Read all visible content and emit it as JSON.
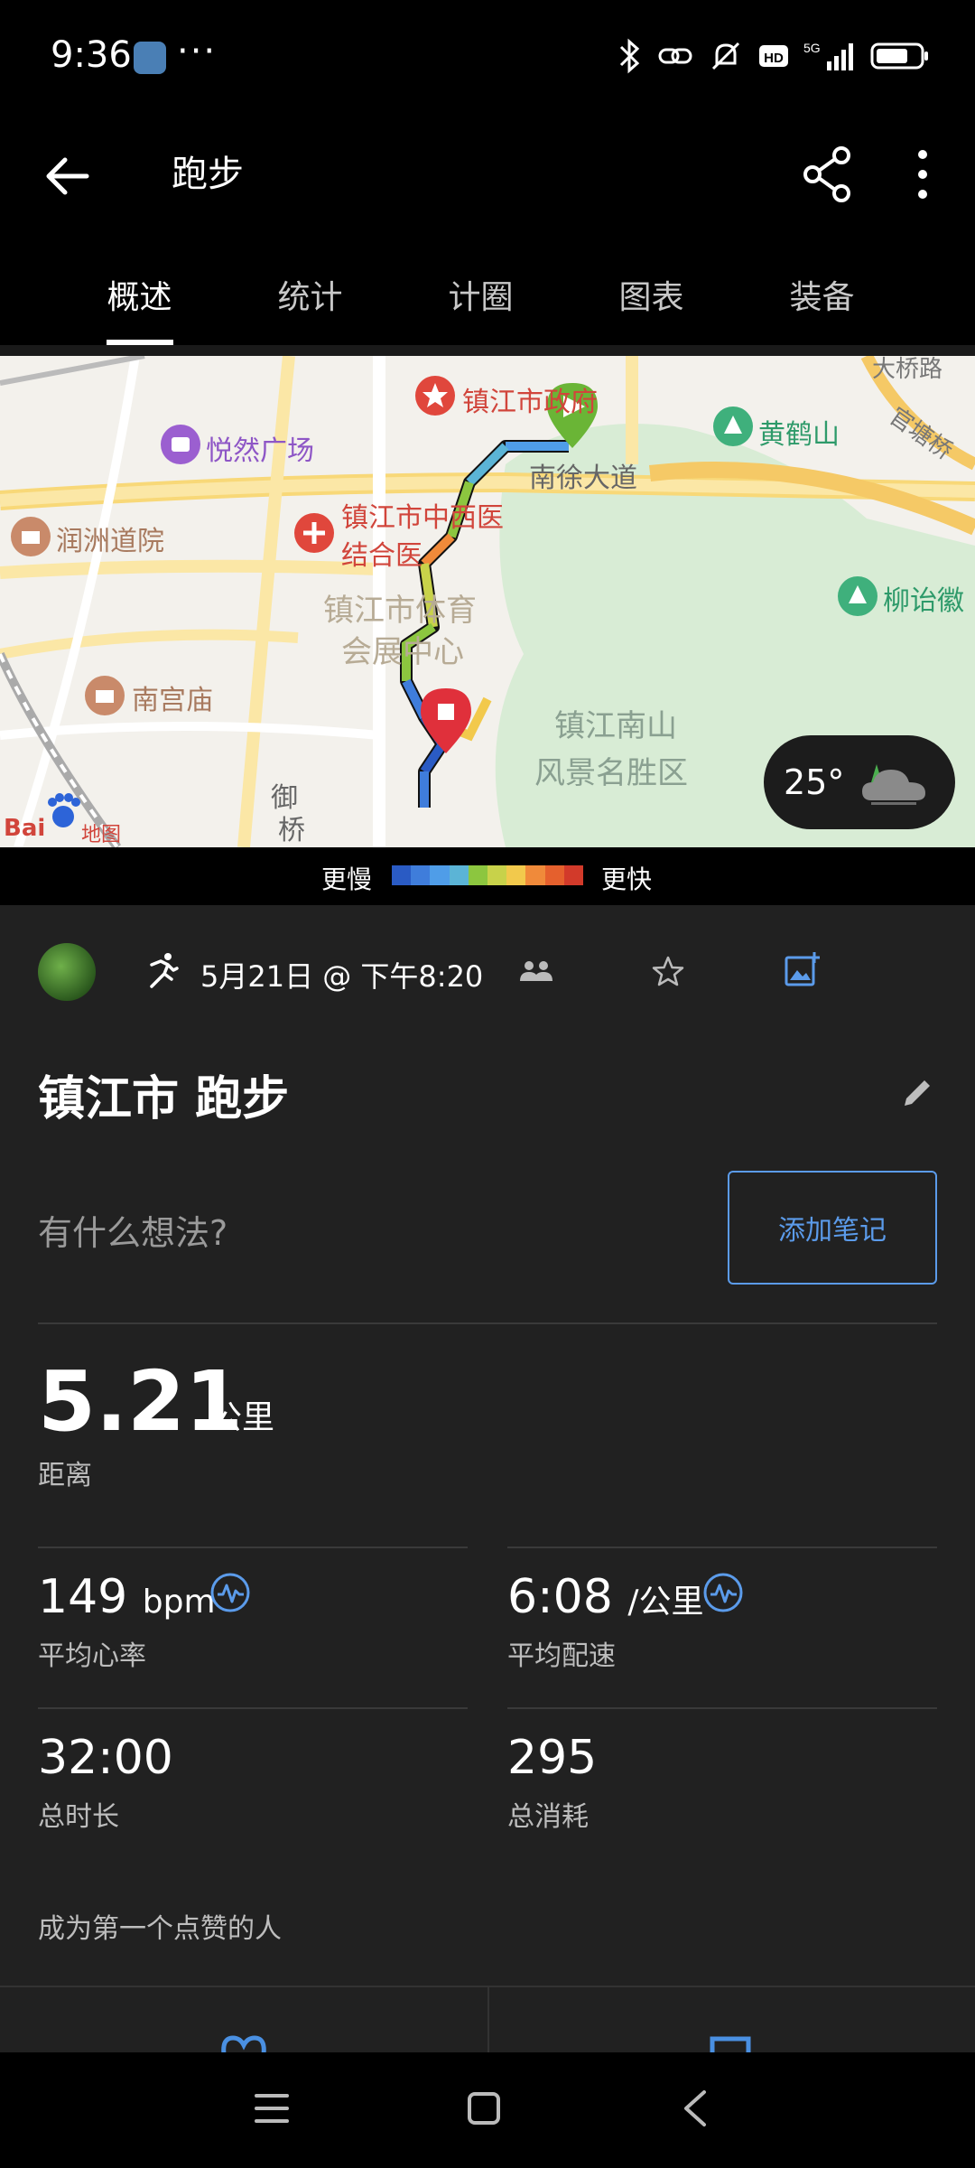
{
  "status_bar": {
    "time": "9:36",
    "overflow": "···",
    "icons": [
      "bluetooth-icon",
      "link-icon",
      "mute-icon",
      "hd-icon",
      "signal-5g-icon",
      "battery-icon"
    ]
  },
  "app_bar": {
    "title": "跑步"
  },
  "tabs": [
    {
      "label": "概述",
      "active": true
    },
    {
      "label": "统计",
      "active": false
    },
    {
      "label": "计圈",
      "active": false
    },
    {
      "label": "图表",
      "active": false
    },
    {
      "label": "装备",
      "active": false
    }
  ],
  "map": {
    "labels": {
      "gov": "镇江市政府",
      "yueran": "悦然广场",
      "nanxu": "南徐大道",
      "huanghe": "黄鹤山",
      "guantang": "官塘桥",
      "daqiao": "大桥路",
      "runzhou": "润洲道院",
      "hospital_1": "镇江市中西医",
      "hospital_2": "结合医",
      "sports_1": "镇江市体育",
      "sports_2": "会展中心",
      "liuyi": "柳诒徽",
      "nangong": "南宫庙",
      "nanshan_1": "镇江南山",
      "nanshan_2": "风景名胜区",
      "yuqiao_1": "御",
      "yuqiao_2": "桥",
      "baidu": "Bai",
      "baidu_map": "地图"
    },
    "weather_temp": "25°"
  },
  "legend": {
    "slow": "更慢",
    "fast": "更快",
    "colors": [
      "#2a5bc4",
      "#3f7ddb",
      "#4f9de8",
      "#5bb4d6",
      "#8cc63f",
      "#c8d24a",
      "#f2c94c",
      "#f08a3a",
      "#e5602d",
      "#d23a2a"
    ]
  },
  "activity": {
    "date": "5月21日 @ 下午8:20",
    "title": "镇江市 跑步",
    "thoughts_placeholder": "有什么想法?",
    "add_note": "添加笔记",
    "distance": {
      "value": "5.21",
      "unit": "公里",
      "label": "距离"
    },
    "heart_rate": {
      "value": "149",
      "unit": "bpm",
      "label": "平均心率"
    },
    "pace": {
      "value": "6:08",
      "unit": "/公里",
      "label": "平均配速"
    },
    "duration": {
      "value": "32:00",
      "label": "总时长"
    },
    "calories": {
      "value": "295",
      "label": "总消耗"
    },
    "likes": "成为第一个点赞的人"
  }
}
